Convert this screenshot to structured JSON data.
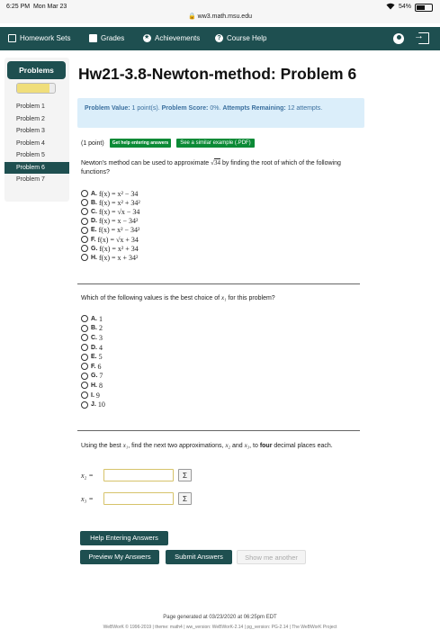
{
  "status": {
    "time": "6:25 PM",
    "date": "Mon Mar 23",
    "url": "ww3.math.msu.edu",
    "battery": "54%"
  },
  "nav": {
    "homework_sets": "Homework Sets",
    "grades": "Grades",
    "achievements": "Achievements",
    "course_help": "Course Help",
    "icons": [
      "list-icon",
      "grades-icon",
      "star-icon",
      "help-icon",
      "user-icon",
      "signout-icon"
    ]
  },
  "sidebar": {
    "header": "Problems",
    "progress_fraction": 0.85,
    "items": [
      {
        "label": "Problem 1"
      },
      {
        "label": "Problem 2"
      },
      {
        "label": "Problem 3"
      },
      {
        "label": "Problem 4"
      },
      {
        "label": "Problem 5"
      },
      {
        "label": "Problem 6"
      },
      {
        "label": "Problem 7"
      }
    ],
    "ellipsis": "...",
    "active_index": 5
  },
  "page": {
    "title": "Hw21-3.8-Newton-method: Problem 6"
  },
  "info": {
    "value_label": "Problem Value:",
    "value_text": "1 point(s).",
    "score_label": "Problem Score:",
    "score_text": "0%.",
    "remaining_label": "Attempts Remaining:",
    "remaining_text": "12 attempts."
  },
  "problem": {
    "points": "(1 point)",
    "help_btn": "Get help entering answers",
    "example_btn": "See a similar example (.PDF)",
    "q1_a": "Newton's method can be used to approximate",
    "q1_b": "34",
    "q1_c": "by finding the root of which of the following functions?",
    "options1": [
      {
        "label": "A.",
        "expr": "f(x) = x² − 34"
      },
      {
        "label": "B.",
        "expr": "f(x) = x² + 34²"
      },
      {
        "label": "C.",
        "expr": "f(x) = √x − 34"
      },
      {
        "label": "D.",
        "expr": "f(x) = x − 34²"
      },
      {
        "label": "E.",
        "expr": "f(x) = x² − 34²"
      },
      {
        "label": "F.",
        "expr": "f(x) = √x + 34"
      },
      {
        "label": "G.",
        "expr": "f(x) = x² + 34"
      },
      {
        "label": "H.",
        "expr": "f(x) = x + 34²"
      }
    ],
    "q2_a": "Which of the following values is the best choice of",
    "q2_var": "x₁",
    "q2_b": "for this problem?",
    "options2": [
      {
        "label": "A.",
        "expr": "1"
      },
      {
        "label": "B.",
        "expr": "2"
      },
      {
        "label": "C.",
        "expr": "3"
      },
      {
        "label": "D.",
        "expr": "4"
      },
      {
        "label": "E.",
        "expr": "5"
      },
      {
        "label": "F.",
        "expr": "6"
      },
      {
        "label": "G.",
        "expr": "7"
      },
      {
        "label": "H.",
        "expr": "8"
      },
      {
        "label": "I.",
        "expr": "9"
      },
      {
        "label": "J.",
        "expr": "10"
      }
    ],
    "q3_a": "Using the best",
    "q3_x1": "x₁",
    "q3_b": ", find the next two approximations,",
    "q3_x2": "x₂",
    "q3_and": "and",
    "q3_x3": "x₃",
    "q3_c": ", to",
    "q3_four": "four",
    "q3_d": "decimal places each.",
    "x2_label": "x₂ =",
    "x3_label": "x₃ =",
    "sigma": "Σ"
  },
  "buttons": {
    "help_entering": "Help Entering Answers",
    "preview": "Preview My Answers",
    "submit": "Submit Answers",
    "show_another": "Show me another"
  },
  "footer": {
    "generated": "Page generated at 03/23/2020 at 06:25pm EDT",
    "copyright": "WeBWorK © 1996-2019 | theme: math4 | ww_version: WeBWorK-2.14 | pg_version: PG-2.14 | The WeBWorK Project"
  }
}
